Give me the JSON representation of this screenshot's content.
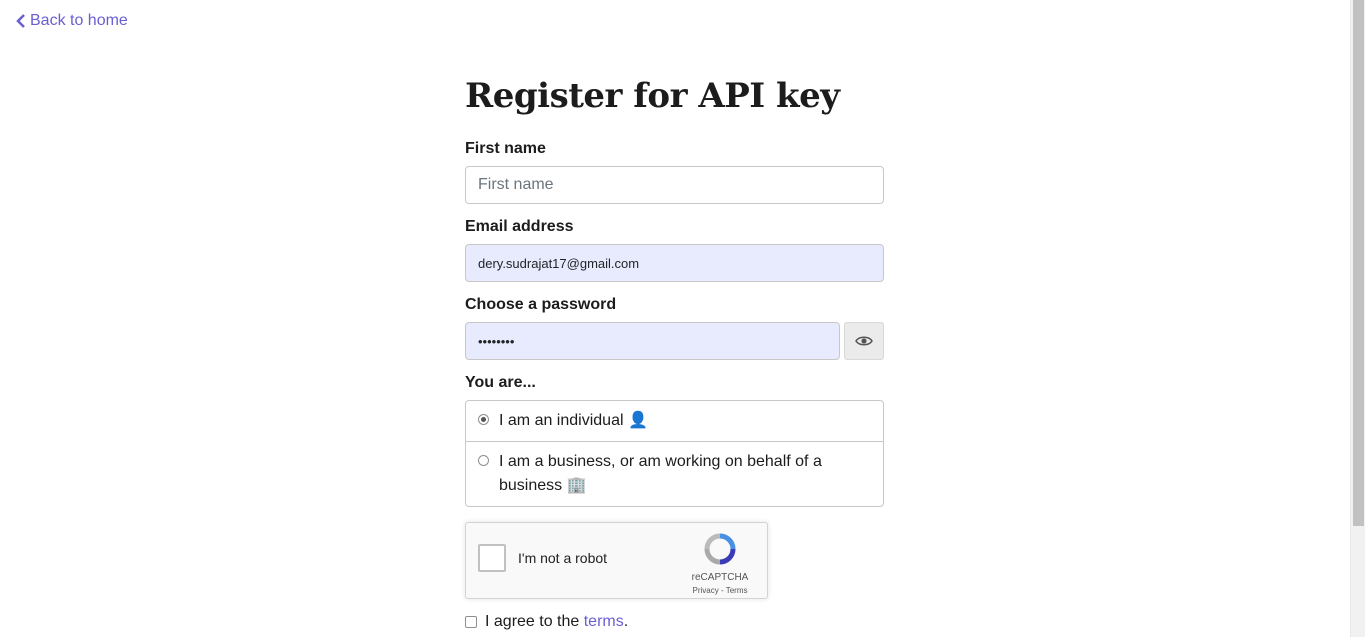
{
  "nav": {
    "back_label": "Back to home"
  },
  "form": {
    "title": "Register for API key",
    "first_name": {
      "label": "First name",
      "placeholder": "First name",
      "value": ""
    },
    "email": {
      "label": "Email address",
      "value": "dery.sudrajat17@gmail.com"
    },
    "password": {
      "label": "Choose a password",
      "value": "••••••••",
      "toggle_icon": "eye-icon"
    },
    "user_type": {
      "label": "You are...",
      "options": [
        {
          "label": "I am an individual 👤",
          "selected": true
        },
        {
          "label": "I am a business, or am working on behalf of a business 🏢",
          "selected": false
        }
      ]
    },
    "captcha": {
      "label": "I'm not a robot",
      "brand": "reCAPTCHA",
      "links": "Privacy - Terms"
    },
    "agree": {
      "prefix": "I agree to the ",
      "link": "terms",
      "suffix": "."
    }
  },
  "colors": {
    "link": "#6a5fd3",
    "autofill": "#e8ebfd"
  }
}
